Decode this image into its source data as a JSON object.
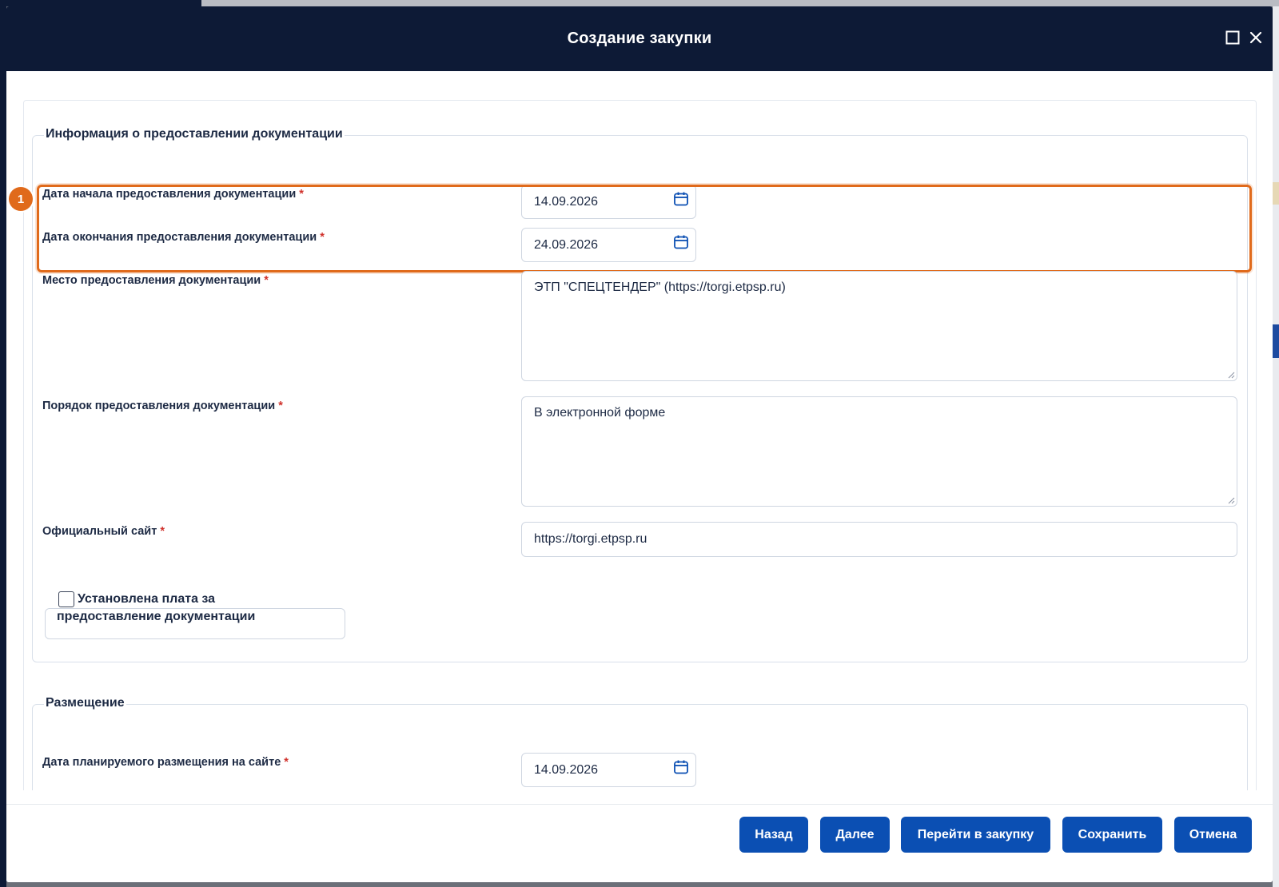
{
  "modal": {
    "title": "Создание закупки"
  },
  "doc_section": {
    "legend": "Информация о предоставлении документации",
    "start_date": {
      "label": "Дата начала предоставления документации",
      "value": "14.09.2026"
    },
    "end_date": {
      "label": "Дата окончания предоставления документации",
      "value": "24.09.2026"
    },
    "place": {
      "label": "Место предоставления документации",
      "value": "ЭТП \"СПЕЦТЕНДЕР\" (https://torgi.etpsp.ru)"
    },
    "order": {
      "label": "Порядок предоставления документации",
      "value": "В электронной форме"
    },
    "site": {
      "label": "Официальный сайт",
      "value": "https://torgi.etpsp.ru"
    },
    "fee_checkbox": {
      "label": "Установлена плата за предоставление документации",
      "checked": false
    }
  },
  "placement_section": {
    "legend": "Размещение",
    "planned_date": {
      "label": "Дата планируемого размещения на сайте",
      "value": "14.09.2026"
    }
  },
  "annotation": {
    "badge": "1",
    "color": "#e06a1b"
  },
  "required_mark": "*",
  "footer": {
    "back": "Назад",
    "next": "Далее",
    "go_to_purchase": "Перейти в закупку",
    "save": "Сохранить",
    "cancel": "Отмена"
  },
  "colors": {
    "header_bg": "#0d1a36",
    "button_bg": "#0b4fb3",
    "required": "#d0302a"
  }
}
